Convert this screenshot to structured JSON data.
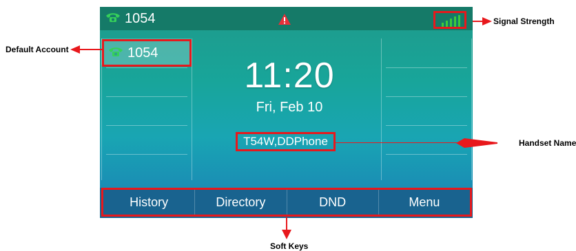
{
  "status_bar": {
    "account_number": "1054",
    "phone_icon": "phone-icon",
    "alert_icon": "warning-icon",
    "signal_icon": "signal-strength-icon"
  },
  "line_keys": {
    "default_account": "1054"
  },
  "idle_screen": {
    "time": "11:20",
    "date": "Fri, Feb 10",
    "handset_name": "T54W,DDPhone"
  },
  "soft_keys": [
    {
      "label": "History"
    },
    {
      "label": "Directory"
    },
    {
      "label": "DND"
    },
    {
      "label": "Menu"
    }
  ],
  "callouts": {
    "signal_strength": "Signal Strength",
    "default_account": "Default Account",
    "handset_name": "Handset Name",
    "soft_keys": "Soft Keys"
  },
  "colors": {
    "status_bar": "#157a68",
    "highlight": "#e8181c",
    "phone_icon": "#35d05a",
    "signal": "#3ccb3c"
  }
}
